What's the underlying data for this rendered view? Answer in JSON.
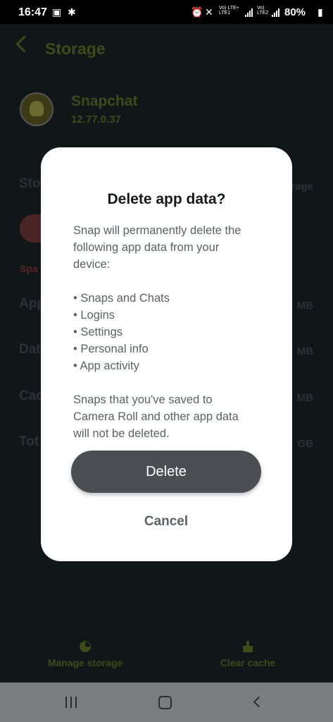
{
  "status_bar": {
    "time": "16:47",
    "sim1_top": "Vo) LTE+",
    "sim1_bottom": "LTE1",
    "sim2_top": "Vo)",
    "sim2_bottom": "LTE2",
    "battery": "80%"
  },
  "background": {
    "title": "Storage",
    "app_name": "Snapchat",
    "app_version": "12.77.0.37",
    "rows": [
      {
        "label": "Sto",
        "right": "rage"
      },
      {
        "label": "Spa"
      },
      {
        "label": "App",
        "right": "MB"
      },
      {
        "label": "Dat",
        "right": "MB"
      },
      {
        "label": "Cac",
        "right": "MB"
      },
      {
        "label": "Tot",
        "right": "GB"
      }
    ],
    "manage_storage": "Manage storage",
    "clear_cache": "Clear cache"
  },
  "dialog": {
    "title": "Delete app data?",
    "intro_line1": "Snap will permanently delete the",
    "intro_line2": "following app data from your",
    "intro_line3": "device:",
    "items": [
      "Snaps and Chats",
      "Logins",
      "Settings",
      "Personal info",
      "App activity"
    ],
    "footer_line1": "Snaps that you've saved to",
    "footer_line2": "Camera Roll and other app data",
    "footer_line3": "will not be deleted.",
    "delete_label": "Delete",
    "cancel_label": "Cancel"
  },
  "icons": {
    "back": "chevron-left-icon",
    "home": "home-icon",
    "recents": "recents-icon"
  }
}
